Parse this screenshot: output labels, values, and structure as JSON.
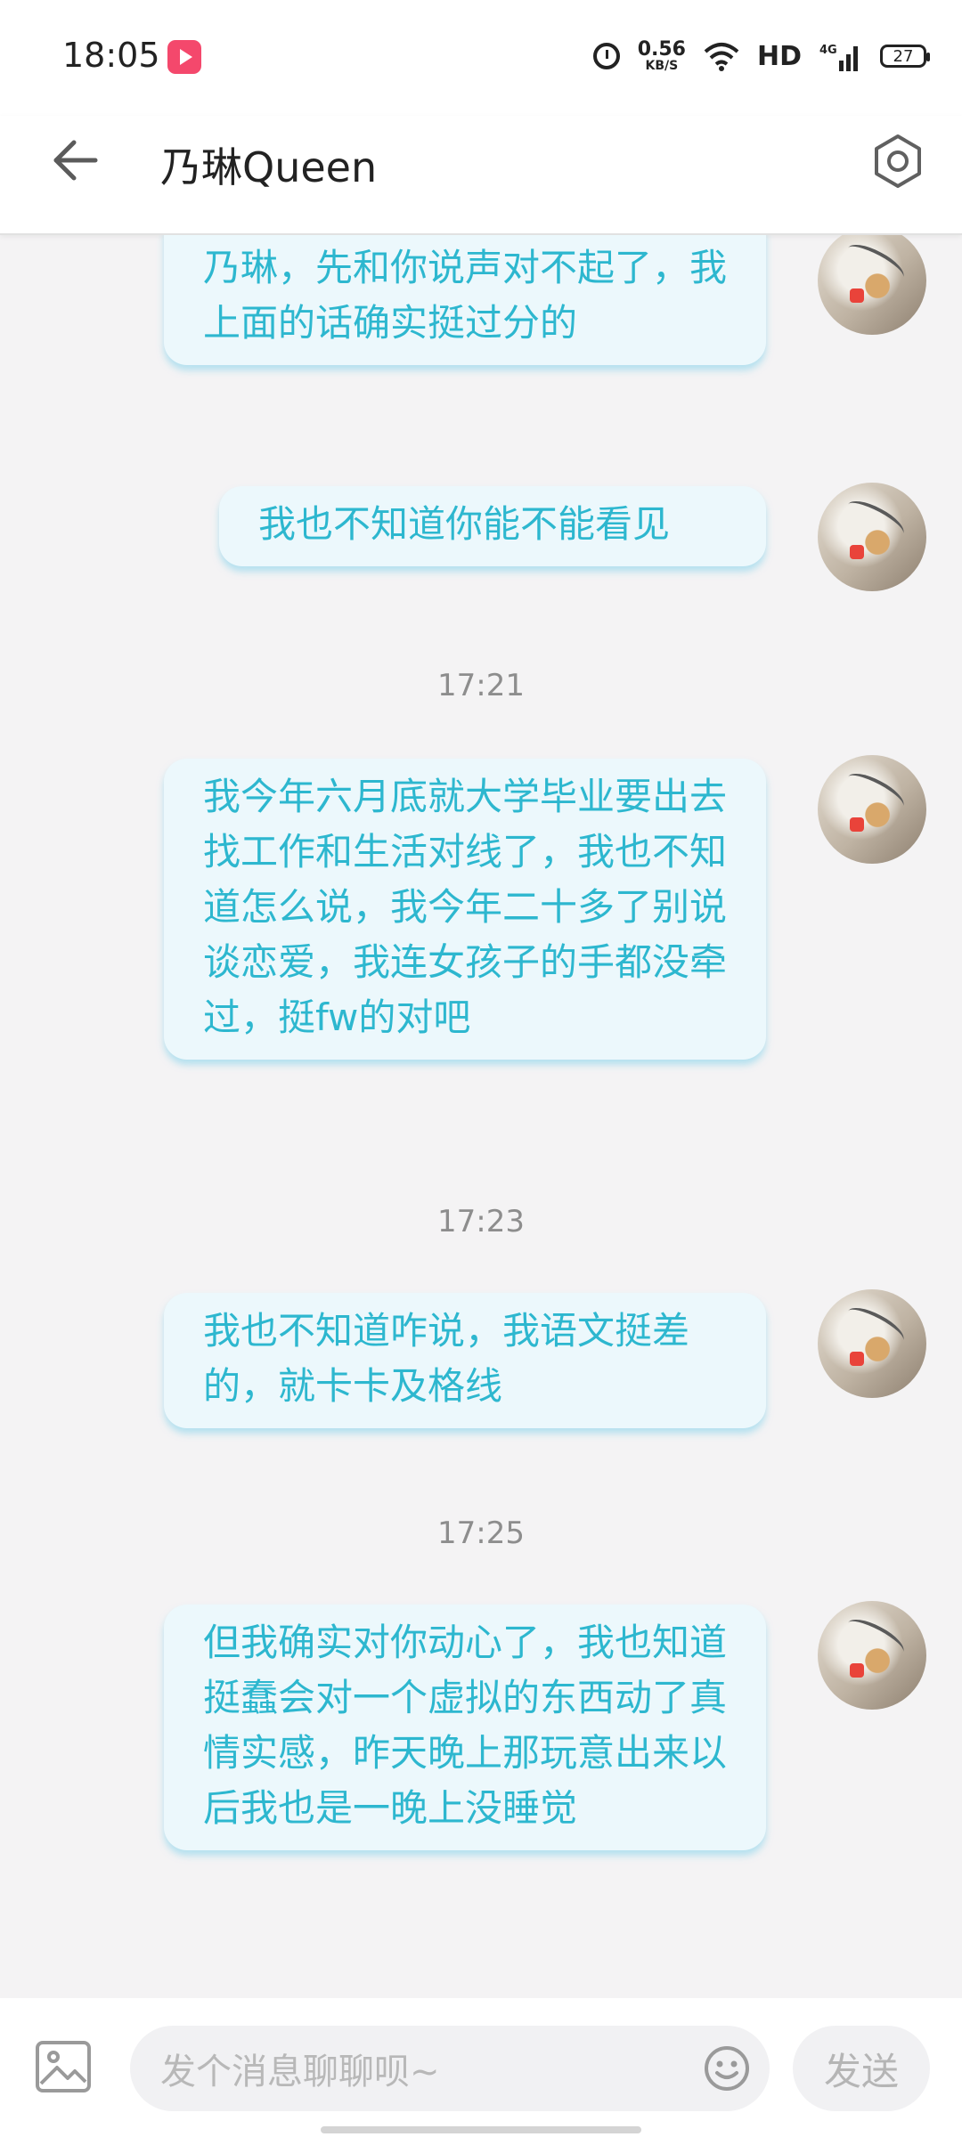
{
  "status": {
    "time": "18:05",
    "speed_value": "0.56",
    "speed_unit": "KB/S",
    "hd": "HD",
    "network": "4G",
    "battery": "27"
  },
  "header": {
    "title": "乃琳Queen",
    "back_icon": "arrow-left-icon",
    "settings_icon": "hexagon-gear-icon"
  },
  "messages": [
    {
      "text": "乃琳，先和你说声对不起了，我上面的话确实挺过分的"
    },
    {
      "text": "我也不知道你能不能看见"
    },
    {
      "time": "17:21"
    },
    {
      "text": "我今年六月底就大学毕业要出去找工作和生活对线了，我也不知道怎么说，我今年二十多了别说谈恋爱，我连女孩子的手都没牵过，挺fw的对吧"
    },
    {
      "time": "17:23"
    },
    {
      "text": "我也不知道咋说，我语文挺差的，就卡卡及格线"
    },
    {
      "time": "17:25"
    },
    {
      "text": "但我确实对你动心了，我也知道挺蠢会对一个虚拟的东西动了真情实感，昨天晚上那玩意出来以后我也是一晚上没睡觉"
    }
  ],
  "input": {
    "placeholder": "发个消息聊聊呗~",
    "send_label": "发送"
  },
  "colors": {
    "bubble_bg": "#ecf8fc",
    "bubble_text": "#2db7cf",
    "page_bg": "#f4f3f4"
  }
}
